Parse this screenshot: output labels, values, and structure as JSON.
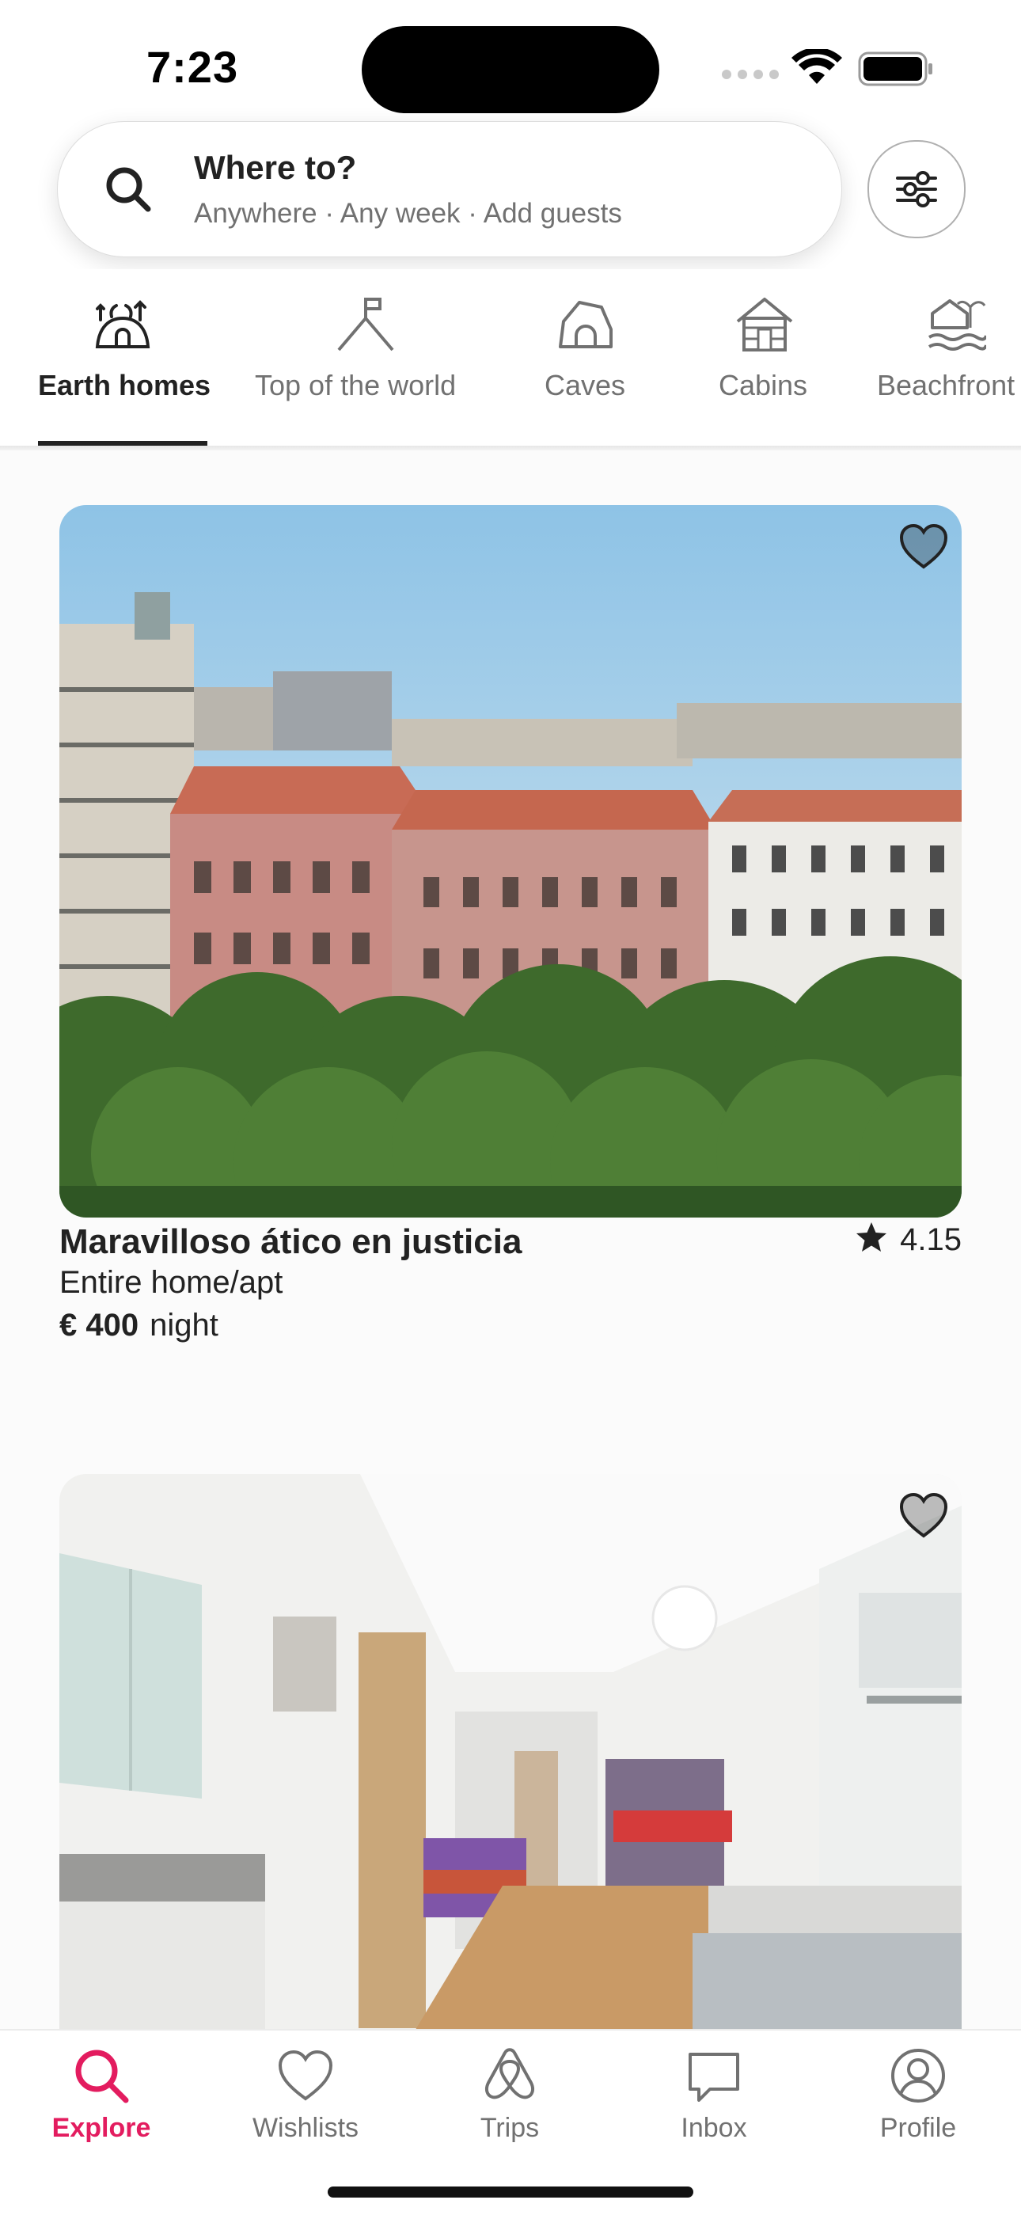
{
  "status_bar": {
    "time": "7:23",
    "icons": [
      "signal-icon",
      "wifi-icon",
      "battery-icon"
    ]
  },
  "search": {
    "title": "Where to?",
    "subtitle": "Anywhere · Any week · Add guests",
    "icon": "search-icon",
    "filter_icon": "sliders-icon"
  },
  "categories": [
    {
      "label": "Earth homes",
      "icon": "earth-home-icon",
      "active": true
    },
    {
      "label": "Top of the world",
      "icon": "mountain-flag-icon",
      "active": false
    },
    {
      "label": "Caves",
      "icon": "cave-icon",
      "active": false
    },
    {
      "label": "Cabins",
      "icon": "cabin-icon",
      "active": false
    },
    {
      "label": "Beachfront",
      "icon": "beachfront-icon",
      "active": false
    }
  ],
  "listings": [
    {
      "title": "Maravilloso ático en justicia",
      "rating": "4.15",
      "type": "Entire home/apt",
      "price": "€ 400",
      "price_unit": "night",
      "photo": "rooftops-city-view-photo"
    },
    {
      "photo": "loft-interior-photo"
    }
  ],
  "tabbar": {
    "tabs": [
      {
        "label": "Explore",
        "icon": "search-icon",
        "active": true
      },
      {
        "label": "Wishlists",
        "icon": "heart-icon",
        "active": false
      },
      {
        "label": "Trips",
        "icon": "airbnb-logo-icon",
        "active": false
      },
      {
        "label": "Inbox",
        "icon": "message-icon",
        "active": false
      },
      {
        "label": "Profile",
        "icon": "profile-icon",
        "active": false
      }
    ]
  },
  "colors": {
    "accent": "#e31c5f",
    "text": "#222222",
    "muted": "#717171"
  }
}
